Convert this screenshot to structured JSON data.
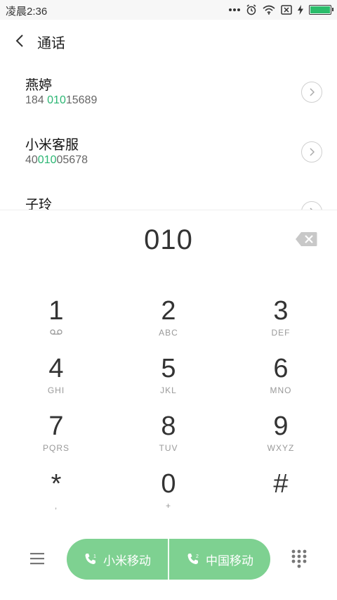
{
  "status_bar": {
    "time": "凌晨2:36",
    "icons": [
      "more-dots-icon",
      "alarm-icon",
      "wifi-icon",
      "sim-none-icon",
      "charging-icon",
      "battery-icon"
    ],
    "battery_color": "#2bbd6b"
  },
  "header": {
    "title": "通话",
    "back_icon": "chevron-left-icon"
  },
  "results": [
    {
      "name": "燕婷",
      "number_pre": "184 ",
      "number_match": "010",
      "number_post": "15689"
    },
    {
      "name": "小米客服",
      "number_pre": "40",
      "number_match": "010",
      "number_post": "05678"
    },
    {
      "name": "子玲",
      "number_pre": "",
      "number_match": "",
      "number_post": ""
    }
  ],
  "dialer": {
    "input": "010",
    "backspace_icon": "backspace-icon"
  },
  "keypad": [
    {
      "digit": "1",
      "sub": ""
    },
    {
      "digit": "2",
      "sub": "ABC"
    },
    {
      "digit": "3",
      "sub": "DEF"
    },
    {
      "digit": "4",
      "sub": "GHI"
    },
    {
      "digit": "5",
      "sub": "JKL"
    },
    {
      "digit": "6",
      "sub": "MNO"
    },
    {
      "digit": "7",
      "sub": "PQRS"
    },
    {
      "digit": "8",
      "sub": "TUV"
    },
    {
      "digit": "9",
      "sub": "WXYZ"
    },
    {
      "digit": "*",
      "sub": ","
    },
    {
      "digit": "0",
      "sub": "+"
    },
    {
      "digit": "#",
      "sub": ""
    }
  ],
  "bottom": {
    "sim1_label": "小米移动",
    "sim2_label": "中国移动",
    "call_color": "#7ed191",
    "highlight_color": "#2bb673"
  }
}
